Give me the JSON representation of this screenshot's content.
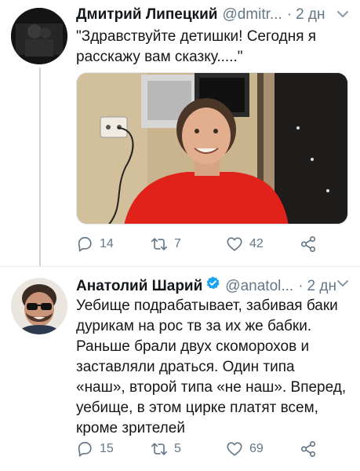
{
  "tweets": [
    {
      "author_name": "Дмитрий Липецкий",
      "handle": "@dmitr...",
      "separator": "·",
      "time": "2 дн",
      "text": "\"Здравствуйте детишки! Сегодня я\nрасскажу вам сказку.....\"",
      "replies": "14",
      "retweets": "7",
      "likes": "42"
    },
    {
      "author_name": "Анатолий Шарий",
      "handle": "@anatol...",
      "separator": "·",
      "time": "2 дн",
      "verified": true,
      "text": "Уебище подрабатывает, забивая баки\nдурикам на рос тв за их же бабки.\nРаньше брали двух скоморохов и\nзаставляли драться. Один типа\n«наш», второй типа «не наш». Вперед,\nуебище, в этом цирке платят всем,\nкроме зрителей",
      "replies": "15",
      "retweets": "5",
      "likes": "69"
    }
  ],
  "icons": {
    "reply": "reply-icon",
    "retweet": "retweet-icon",
    "like": "heart-icon",
    "share": "share-icon",
    "verified": "verified-badge-icon",
    "more": "chevron-down-icon"
  },
  "colors": {
    "text": "#14171a",
    "secondary": "#657786",
    "verified": "#1da1f2",
    "thread_line": "#ccd6dd",
    "media_shirt": "#e0221b"
  }
}
